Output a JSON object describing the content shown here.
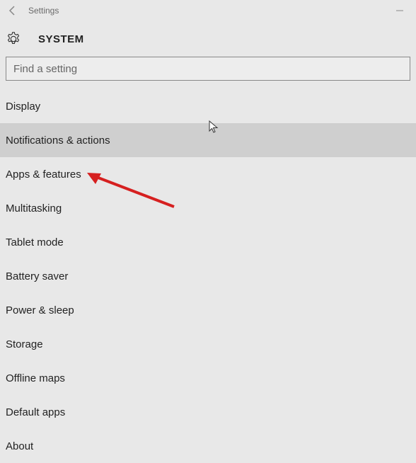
{
  "titlebar": {
    "back_icon": "back-arrow-icon",
    "title": "Settings",
    "minimize": "—"
  },
  "header": {
    "gear_icon": "gear-icon",
    "page_title": "SYSTEM"
  },
  "search": {
    "placeholder": "Find a setting"
  },
  "nav": {
    "items": [
      {
        "label": "Display"
      },
      {
        "label": "Notifications & actions"
      },
      {
        "label": "Apps & features"
      },
      {
        "label": "Multitasking"
      },
      {
        "label": "Tablet mode"
      },
      {
        "label": "Battery saver"
      },
      {
        "label": "Power & sleep"
      },
      {
        "label": "Storage"
      },
      {
        "label": "Offline maps"
      },
      {
        "label": "Default apps"
      },
      {
        "label": "About"
      }
    ],
    "hovered_index": 1,
    "highlighted_index": 2
  }
}
